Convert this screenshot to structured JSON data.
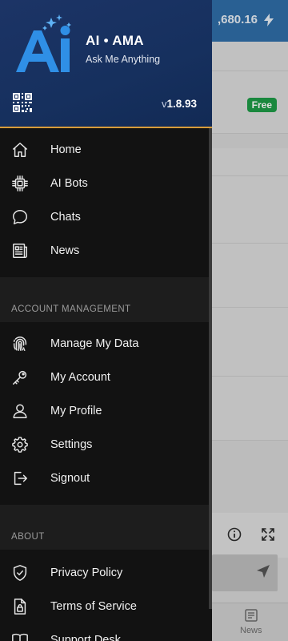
{
  "background": {
    "credits": ",680.16",
    "free_badge": "Free",
    "bottom_nav_news": "News"
  },
  "header": {
    "title": "AI • AMA",
    "subtitle": "Ask Me Anything",
    "version_prefix": "v",
    "version_number": "1.8.93"
  },
  "menu": {
    "main": [
      {
        "label": "Home",
        "icon": "home-icon"
      },
      {
        "label": "AI Bots",
        "icon": "chip-icon"
      },
      {
        "label": "Chats",
        "icon": "chat-bubble-icon"
      },
      {
        "label": "News",
        "icon": "newspaper-icon"
      }
    ],
    "account_header": "ACCOUNT MANAGEMENT",
    "account": [
      {
        "label": "Manage My Data",
        "icon": "fingerprint-icon"
      },
      {
        "label": "My Account",
        "icon": "key-icon"
      },
      {
        "label": "My Profile",
        "icon": "user-icon"
      },
      {
        "label": "Settings",
        "icon": "gear-icon"
      },
      {
        "label": "Signout",
        "icon": "logout-icon"
      }
    ],
    "about_header": "ABOUT",
    "about": [
      {
        "label": "Privacy Policy",
        "icon": "shield-check-icon"
      },
      {
        "label": "Terms of Service",
        "icon": "document-lock-icon"
      },
      {
        "label": "Support Desk",
        "icon": "book-icon"
      }
    ]
  }
}
